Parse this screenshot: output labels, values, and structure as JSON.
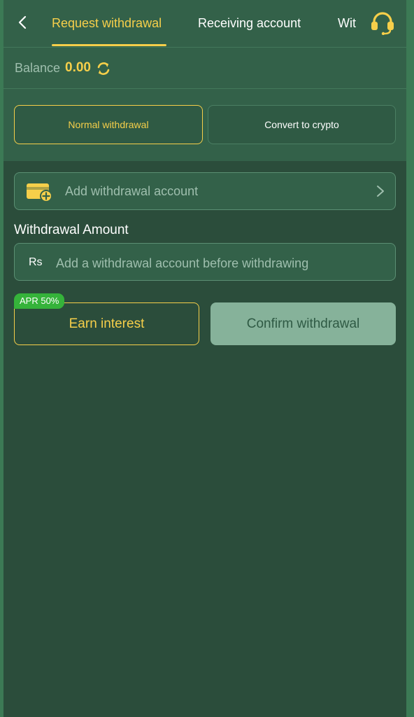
{
  "header": {
    "tabs": [
      {
        "label": "Request withdrawal",
        "active": true
      },
      {
        "label": "Receiving account",
        "active": false
      },
      {
        "label": "Wit",
        "active": false
      }
    ],
    "icons": {
      "back": "chevron-left-icon",
      "support": "headset-icon"
    }
  },
  "balance": {
    "label": "Balance",
    "value": "0.00",
    "icon": "refresh-icon"
  },
  "modes": {
    "normal": "Normal withdrawal",
    "crypto": "Convert to crypto",
    "selected": "normal"
  },
  "account": {
    "label": "Add withdrawal account",
    "icon": "wallet-add-icon"
  },
  "amount": {
    "label": "Withdrawal Amount",
    "currency": "Rs",
    "placeholder": "Add a withdrawal account before withdrawing"
  },
  "actions": {
    "earn_label": "Earn interest",
    "apr_badge": "APR 50%",
    "confirm_label": "Confirm withdrawal"
  },
  "colors": {
    "accent": "#f6cf4a",
    "background": "#2b4d3b",
    "surface": "#336149",
    "badge": "#35b33a",
    "disabled_button": "#86b29a"
  }
}
